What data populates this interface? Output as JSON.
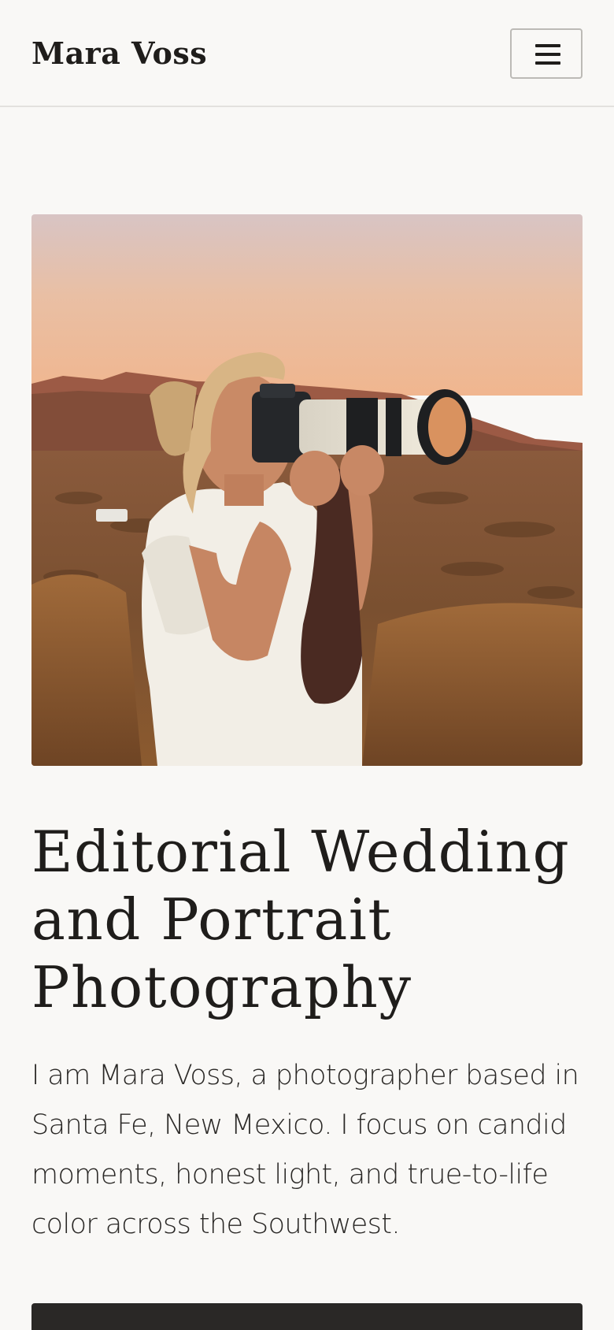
{
  "header": {
    "brand": "Mara Voss",
    "menu_icon": "hamburger-menu-icon"
  },
  "hero": {
    "image_description": "Photographer with camera in desert landscape at sunset",
    "headline": "Editorial Wedding and Portrait Photography",
    "intro": "I am Mara Voss, a photographer based in Santa Fe, New Mexico. I focus on candid moments, honest light, and true-to-life color across the Southwest."
  },
  "colors": {
    "background": "#f9f8f6",
    "text": "#1f1d1b",
    "cta": "#2a2826",
    "divider": "#e3e1de"
  }
}
